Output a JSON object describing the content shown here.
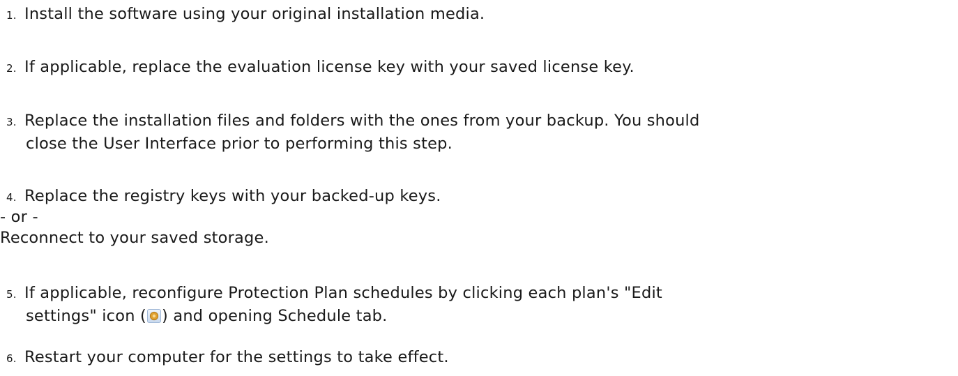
{
  "steps": [
    {
      "num": "1.",
      "text": "Install the software using your original installation media."
    },
    {
      "num": "2.",
      "text": "If applicable, replace the evaluation license key with your saved license key."
    },
    {
      "num": "3.",
      "line1": "Replace the installation files and folders with the ones from your backup. You should",
      "line2": "close the User Interface prior to performing this step."
    },
    {
      "num": "4.",
      "text": "Replace the registry keys with your backed-up keys."
    },
    {
      "num": "5.",
      "line1": "If applicable, reconfigure Protection Plan schedules by clicking each plan's \"Edit",
      "line2_before": "settings\" icon (",
      "line2_after": ") and opening Schedule tab."
    },
    {
      "num": "6.",
      "text": "Restart your computer for the settings to take effect."
    }
  ],
  "or_separator": "- or -",
  "alt_step_text": "Reconnect to your saved storage.",
  "icons": {
    "edit_settings": "gear-icon",
    "edit_settings_color": "#e0a030"
  }
}
